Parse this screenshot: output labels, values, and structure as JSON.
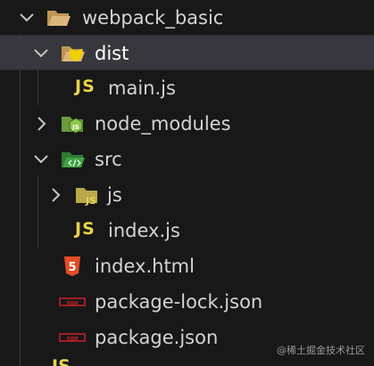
{
  "tree": {
    "root": {
      "label": "webpack_basic",
      "icon": "folder-open-icon",
      "expanded": true
    },
    "dist": {
      "label": "dist",
      "icon": "dist-folder-open-icon",
      "expanded": true
    },
    "main_js": {
      "label": "main.js",
      "icon": "javascript-file-icon",
      "badge": "JS"
    },
    "node_modules": {
      "label": "node_modules",
      "icon": "node-folder-icon",
      "expanded": false
    },
    "src": {
      "label": "src",
      "icon": "src-folder-open-icon",
      "expanded": true
    },
    "js_folder": {
      "label": "js",
      "icon": "js-folder-icon",
      "badge": "JS",
      "expanded": false
    },
    "index_js": {
      "label": "index.js",
      "icon": "javascript-file-icon",
      "badge": "JS"
    },
    "index_html": {
      "label": "index.html",
      "icon": "html5-file-icon",
      "badge": "5"
    },
    "package_lock": {
      "label": "package-lock.json",
      "icon": "npm-file-icon",
      "badge": "npm"
    },
    "package_json": {
      "label": "package.json",
      "icon": "npm-file-icon",
      "badge": "npm"
    },
    "partial_next": {
      "badge": "JS"
    }
  },
  "watermark": "@稀土掘金技术社区",
  "colors": {
    "background": "#181818",
    "selected_row": "#37373d",
    "js_yellow": "#e8d44d",
    "html_orange": "#e44d26",
    "npm_red": "#c12127",
    "node_green": "#8cc84b",
    "folder_tan": "#c09553"
  }
}
